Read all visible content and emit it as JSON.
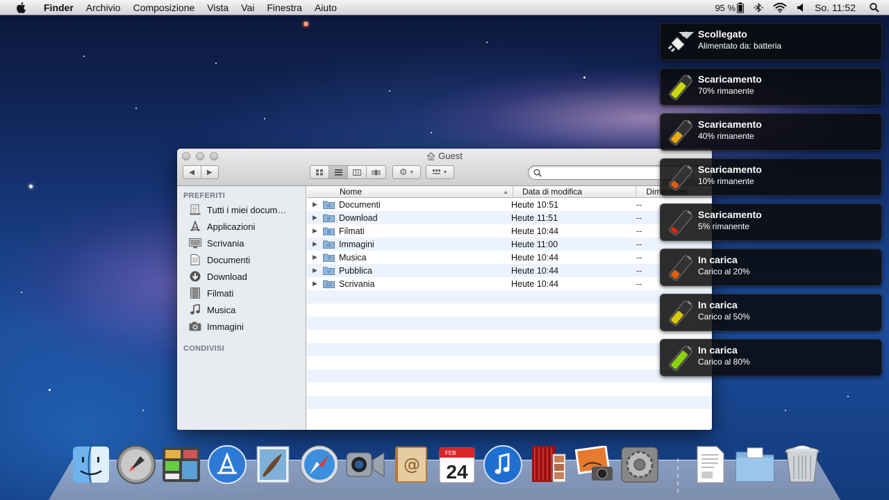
{
  "menubar": {
    "app_name": "Finder",
    "menus": [
      "Archivio",
      "Composizione",
      "Vista",
      "Vai",
      "Finestra",
      "Aiuto"
    ],
    "battery": "95 %",
    "clock": "So. 11:52"
  },
  "finder": {
    "title": "Guest",
    "search_placeholder": "",
    "sidebar": {
      "favorites_header": "PREFERITI",
      "items": [
        {
          "label": "Tutti i miei docum…",
          "icon": "all-documents-icon"
        },
        {
          "label": "Applicazioni",
          "icon": "applications-icon"
        },
        {
          "label": "Scrivania",
          "icon": "desktop-icon"
        },
        {
          "label": "Documenti",
          "icon": "documents-icon"
        },
        {
          "label": "Download",
          "icon": "download-icon"
        },
        {
          "label": "Filmati",
          "icon": "movies-icon"
        },
        {
          "label": "Musica",
          "icon": "music-icon"
        },
        {
          "label": "Immagini",
          "icon": "pictures-icon"
        }
      ],
      "shared_header": "CONDIVISI"
    },
    "columns": {
      "name": "Nome",
      "date": "Data di modifica",
      "size": "Dimensioni"
    },
    "rows": [
      {
        "name": "Documenti",
        "date": "Heute 10:51",
        "size": "--"
      },
      {
        "name": "Download",
        "date": "Heute 11:51",
        "size": "--"
      },
      {
        "name": "Filmati",
        "date": "Heute 10:44",
        "size": "--"
      },
      {
        "name": "Immagini",
        "date": "Heute 11:00",
        "size": "--"
      },
      {
        "name": "Musica",
        "date": "Heute 10:44",
        "size": "--"
      },
      {
        "name": "Pubblica",
        "date": "Heute 10:44",
        "size": "--"
      },
      {
        "name": "Scrivania",
        "date": "Heute 10:44",
        "size": "--"
      }
    ]
  },
  "notifications": [
    {
      "title": "Scollegato",
      "subtitle": "Alimentato da: batteria",
      "icon": "power-plug-icon",
      "color": "#ffffff"
    },
    {
      "title": "Scaricamento",
      "subtitle": "70% rimanente",
      "icon": "battery-icon",
      "color": "#c8d80a"
    },
    {
      "title": "Scaricamento",
      "subtitle": "40% rimanente",
      "icon": "battery-icon",
      "color": "#e6a810"
    },
    {
      "title": "Scaricamento",
      "subtitle": "10% rimanente",
      "icon": "battery-icon",
      "color": "#e25a10"
    },
    {
      "title": "Scaricamento",
      "subtitle": "5% rimanente",
      "icon": "battery-icon",
      "color": "#e02a10"
    },
    {
      "title": "In carica",
      "subtitle": "Carico al 20%",
      "icon": "battery-icon",
      "color": "#e06010"
    },
    {
      "title": "In carica",
      "subtitle": "Carico al 50%",
      "icon": "battery-icon",
      "color": "#d8c80a"
    },
    {
      "title": "In carica",
      "subtitle": "Carico al 80%",
      "icon": "battery-icon",
      "color": "#8cd010"
    }
  ],
  "dock": {
    "calendar_month": "FEB",
    "calendar_day": "24",
    "items": [
      "finder-icon",
      "launchpad-icon",
      "dashboard-icon",
      "app-store-icon",
      "mail-icon",
      "safari-icon",
      "facetime-icon",
      "address-book-icon",
      "calendar-icon",
      "itunes-icon",
      "photo-booth-icon",
      "iphoto-icon",
      "system-preferences-icon",
      "document-stack-icon",
      "folder-stack-icon",
      "trash-icon"
    ]
  }
}
